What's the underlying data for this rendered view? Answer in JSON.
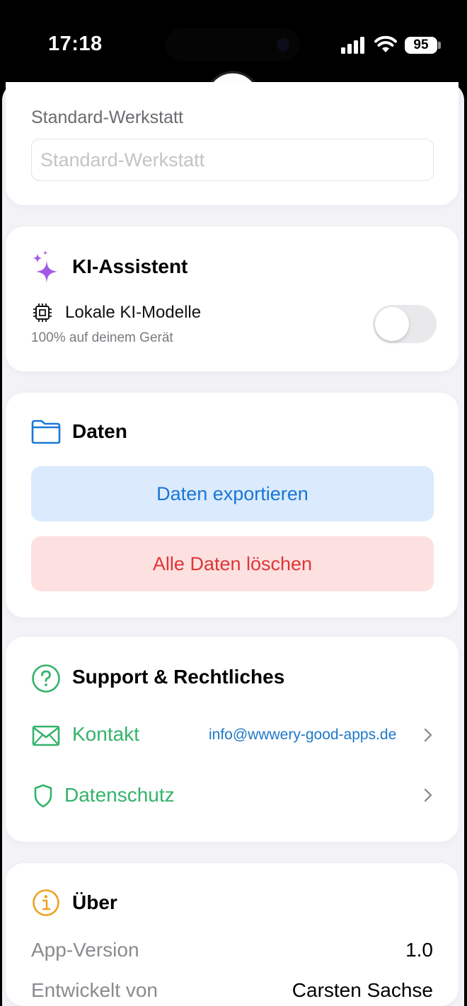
{
  "status_bar": {
    "time": "17:18",
    "battery": "95"
  },
  "default_workshop": {
    "label": "Standard-Werkstatt",
    "placeholder": "Standard-Werkstatt",
    "value": ""
  },
  "ai": {
    "title": "KI-Assistent",
    "local_models_label": "Lokale KI-Modelle",
    "local_models_sub": "100% auf deinem Gerät",
    "toggle_on": false
  },
  "data_section": {
    "title": "Daten",
    "export_label": "Daten exportieren",
    "delete_label": "Alle Daten löschen"
  },
  "support": {
    "title": "Support & Rechtliches",
    "contact_label": "Kontakt",
    "contact_email": "info@wwwery-good-apps.de",
    "privacy_label": "Datenschutz"
  },
  "about": {
    "title": "Über",
    "version_label": "App-Version",
    "version_value": "1.0",
    "developer_label": "Entwickelt von",
    "developer_value": "Carsten Sachse"
  },
  "colors": {
    "accent_blue": "#1877d6",
    "danger_red": "#e03535",
    "link_green": "#34b36a",
    "ai_purple": "#a259e6",
    "info_orange": "#f0a020"
  },
  "icons": [
    "signal-icon",
    "wifi-icon",
    "battery-icon",
    "sparkles-icon",
    "cpu-icon",
    "folder-icon",
    "question-icon",
    "envelope-icon",
    "shield-icon",
    "chevron-right-icon",
    "info-icon"
  ]
}
